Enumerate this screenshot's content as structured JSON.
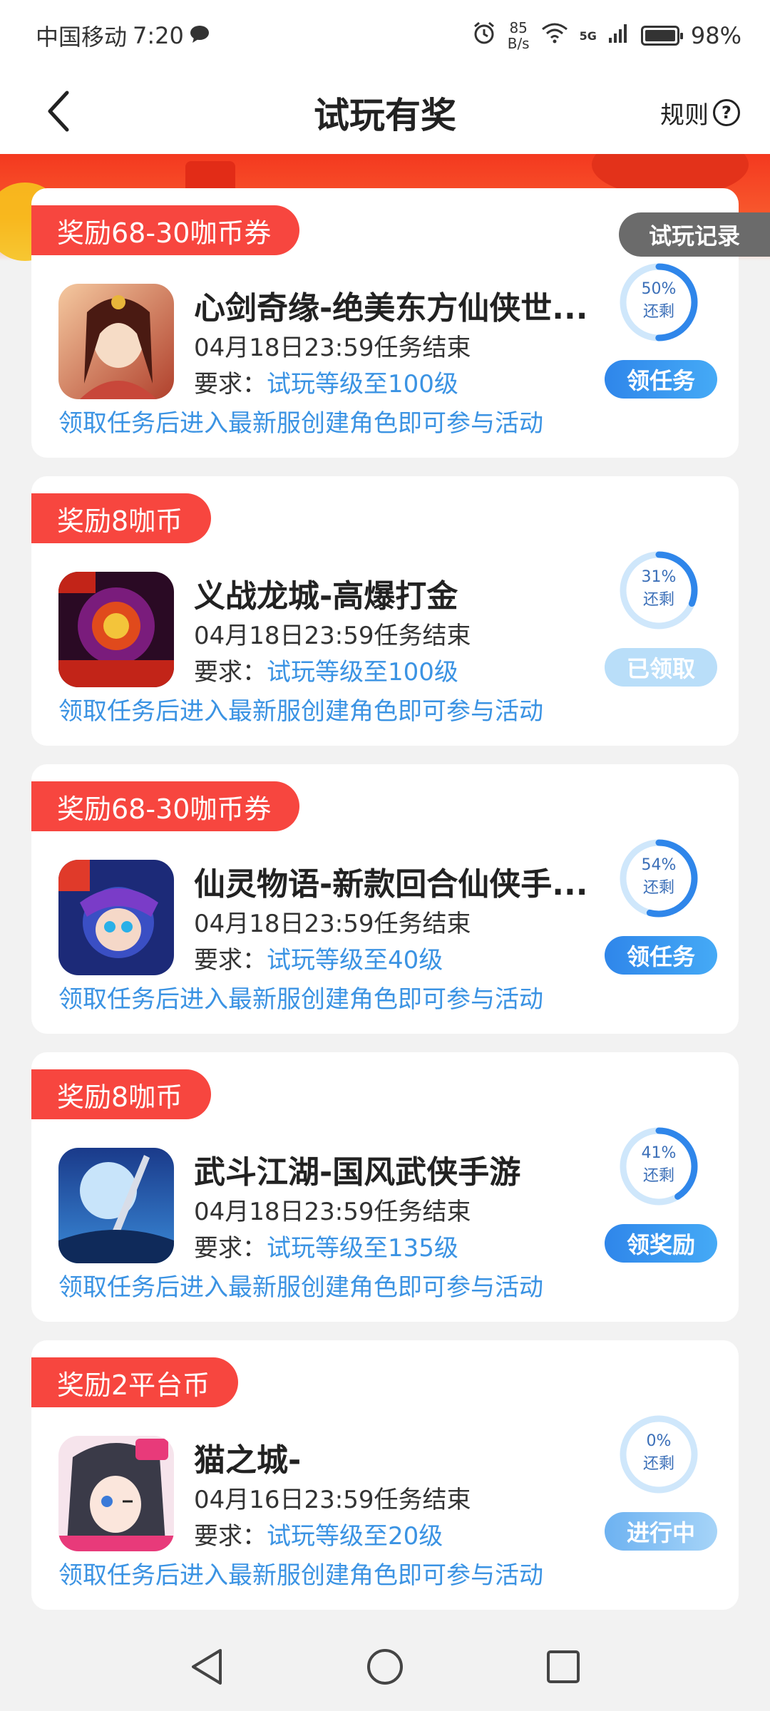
{
  "status_bar": {
    "carrier": "中国移动",
    "time": "7:20",
    "net_speed_value": "85",
    "net_speed_unit": "B/s",
    "network": "5G",
    "battery": "98%"
  },
  "header": {
    "title": "试玩有奖",
    "rules_label": "规则",
    "help_symbol": "?"
  },
  "record_tab": "试玩记录",
  "tasks": [
    {
      "reward": "奖励68-30咖币券",
      "name": "心剑奇缘-绝美东方仙侠世...",
      "deadline": "04月18日23:59任务结束",
      "req_label": "要求：",
      "req_value": "试玩等级至100级",
      "hint": "领取任务后进入最新服创建角色即可参与活动",
      "remaining_pct": "50%",
      "remaining_fraction": 0.5,
      "remaining_label": "还剩",
      "button": "领任务"
    },
    {
      "reward": "奖励8咖币",
      "name": "义战龙城-高爆打金",
      "deadline": "04月18日23:59任务结束",
      "req_label": "要求：",
      "req_value": "试玩等级至100级",
      "hint": "领取任务后进入最新服创建角色即可参与活动",
      "remaining_pct": "31%",
      "remaining_fraction": 0.31,
      "remaining_label": "还剩",
      "button": "已领取"
    },
    {
      "reward": "奖励68-30咖币券",
      "name": "仙灵物语-新款回合仙侠手...",
      "deadline": "04月18日23:59任务结束",
      "req_label": "要求：",
      "req_value": "试玩等级至40级",
      "hint": "领取任务后进入最新服创建角色即可参与活动",
      "remaining_pct": "54%",
      "remaining_fraction": 0.54,
      "remaining_label": "还剩",
      "button": "领任务"
    },
    {
      "reward": "奖励8咖币",
      "name": "武斗江湖-国风武侠手游",
      "deadline": "04月18日23:59任务结束",
      "req_label": "要求：",
      "req_value": "试玩等级至135级",
      "hint": "领取任务后进入最新服创建角色即可参与活动",
      "remaining_pct": "41%",
      "remaining_fraction": 0.41,
      "remaining_label": "还剩",
      "button": "领奖励"
    },
    {
      "reward": "奖励2平台币",
      "name": "猫之城-",
      "deadline": "04月16日23:59任务结束",
      "req_label": "要求：",
      "req_value": "试玩等级至20级",
      "hint": "领取任务后进入最新服创建角色即可参与活动",
      "remaining_pct": "0%",
      "remaining_fraction": 0.0,
      "remaining_label": "还剩",
      "button": "进行中"
    }
  ],
  "icons": {
    "back": "back-arrow-icon",
    "help": "question-circle-icon",
    "nav_back": "triangle-back-icon",
    "nav_home": "circle-home-icon",
    "nav_recent": "square-recent-icon"
  },
  "colors": {
    "accent_red": "#f7463f",
    "accent_blue": "#3b93e3",
    "button_blue": "#2f86ea",
    "button_claimed": "#b9def9"
  }
}
